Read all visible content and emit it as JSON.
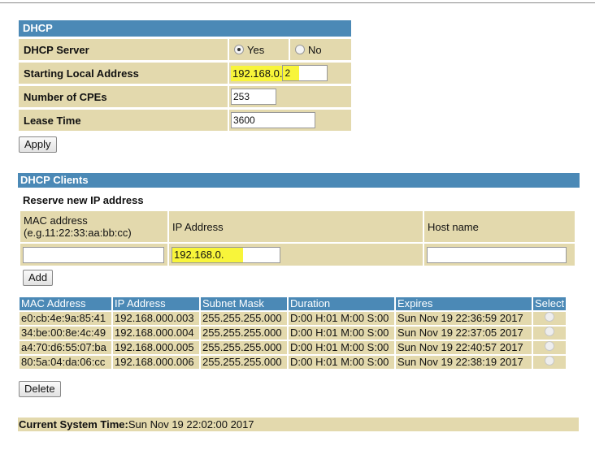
{
  "dhcp": {
    "header": "DHCP",
    "server_label": "DHCP Server",
    "server_yes": "Yes",
    "server_no": "No",
    "start_label": "Starting Local Address",
    "start_prefix": "192.168.0.",
    "start_value": "2",
    "cpes_label": "Number of CPEs",
    "cpes_value": "253",
    "lease_label": "Lease Time",
    "lease_value": "3600",
    "apply_label": "Apply"
  },
  "clients": {
    "header": "DHCP Clients",
    "reserve_title": "Reserve new IP address",
    "mac_header": "MAC address\n(e.g.11:22:33:aa:bb:cc)",
    "ip_header": "IP Address",
    "host_header": "Host name",
    "ip_prefix": "192.168.0.",
    "add_label": "Add",
    "columns": [
      "MAC Address",
      "IP Address",
      "Subnet Mask",
      "Duration",
      "Expires",
      "Select"
    ],
    "rows": [
      [
        "e0:cb:4e:9a:85:41",
        "192.168.000.003",
        "255.255.255.000",
        "D:00 H:01 M:00 S:00",
        "Sun Nov 19 22:36:59 2017"
      ],
      [
        "34:be:00:8e:4c:49",
        "192.168.000.004",
        "255.255.255.000",
        "D:00 H:01 M:00 S:00",
        "Sun Nov 19 22:37:05 2017"
      ],
      [
        "a4:70:d6:55:07:ba",
        "192.168.000.005",
        "255.255.255.000",
        "D:00 H:01 M:00 S:00",
        "Sun Nov 19 22:40:57 2017"
      ],
      [
        "80:5a:04:da:06:cc",
        "192.168.000.006",
        "255.255.255.000",
        "D:00 H:01 M:00 S:00",
        "Sun Nov 19 22:38:19 2017"
      ]
    ],
    "delete_label": "Delete"
  },
  "footer": {
    "label": "Current System Time:",
    "value": "Sun Nov 19 22:02:00 2017"
  },
  "colors": {
    "header_blue": "#4b89b6",
    "row_tan": "#e3d9ad",
    "highlight_yellow": "#f8f53a"
  }
}
